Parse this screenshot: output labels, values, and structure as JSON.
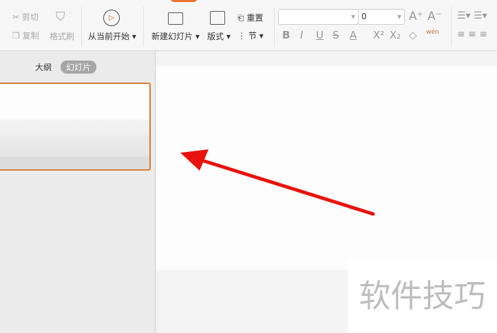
{
  "toolbar": {
    "cut": "剪切",
    "copy": "复制",
    "format_painter": "格式刷",
    "play_from_current": "从当前开始",
    "new_slide": "新建幻灯片",
    "layout": "版式",
    "reset": "重置",
    "section": "节",
    "font_name": "",
    "font_size": "0",
    "grow_font": "A⁺",
    "shrink_font": "A⁻",
    "bold": "B",
    "italic": "I",
    "underline": "U",
    "strike": "S",
    "font_color": "A",
    "superscript": "X²",
    "subscript": "X₂",
    "clear": "◇",
    "phonetic": "wén"
  },
  "panel": {
    "tabs": [
      {
        "label": "大纲",
        "active": false
      },
      {
        "label": "幻灯片",
        "active": true
      }
    ]
  },
  "watermark": "软件技巧",
  "colors": {
    "accent": "#d9782f",
    "arrow": "#e8130c"
  }
}
